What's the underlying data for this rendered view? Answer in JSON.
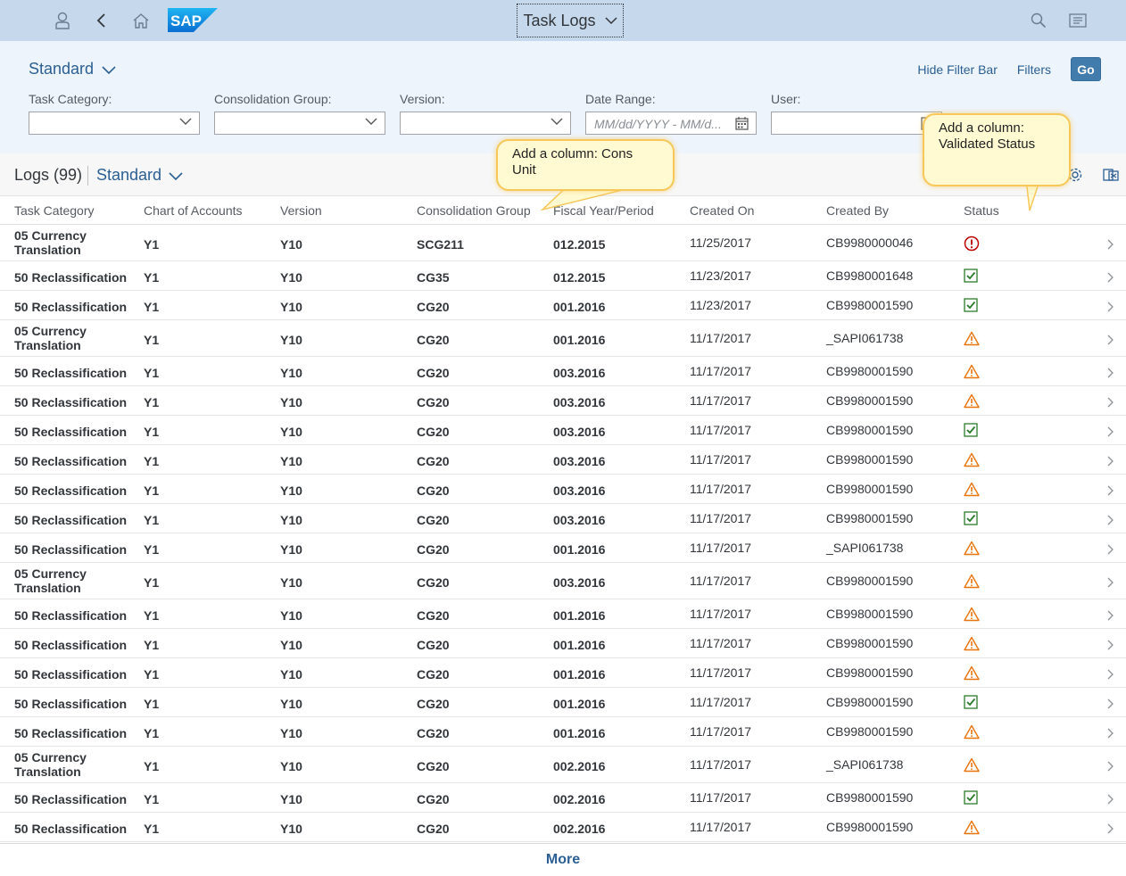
{
  "shell": {
    "title": "Task Logs",
    "logo_text": "SAP"
  },
  "filterbar": {
    "variant": "Standard",
    "hide_filter_bar": "Hide Filter Bar",
    "filters": "Filters",
    "go": "Go",
    "fields": [
      {
        "label": "Task Category:",
        "value": "",
        "placeholder": ""
      },
      {
        "label": "Consolidation Group:",
        "value": "",
        "placeholder": ""
      },
      {
        "label": "Version:",
        "value": "",
        "placeholder": ""
      },
      {
        "label": "Date Range:",
        "value": "",
        "placeholder": "MM/dd/YYYY - MM/d..."
      },
      {
        "label": "User:",
        "value": "",
        "placeholder": ""
      }
    ]
  },
  "table": {
    "title": "Logs (99)",
    "variant": "Standard",
    "columns": [
      "Task Category",
      "Chart of Accounts",
      "Version",
      "Consolidation Group",
      "Fiscal Year/Period",
      "Created On",
      "Created By",
      "Status"
    ],
    "rows": [
      {
        "cat": "05 Currency Translation",
        "coa": "Y1",
        "ver": "Y10",
        "cg": "SCG211",
        "fy": "012.2015",
        "co": "11/25/2017",
        "cb": "CB9980000046",
        "status": "error"
      },
      {
        "cat": "50 Reclassification",
        "coa": "Y1",
        "ver": "Y10",
        "cg": "CG35",
        "fy": "012.2015",
        "co": "11/23/2017",
        "cb": "CB9980001648",
        "status": "success"
      },
      {
        "cat": "50 Reclassification",
        "coa": "Y1",
        "ver": "Y10",
        "cg": "CG20",
        "fy": "001.2016",
        "co": "11/23/2017",
        "cb": "CB9980001590",
        "status": "success"
      },
      {
        "cat": "05 Currency Translation",
        "coa": "Y1",
        "ver": "Y10",
        "cg": "CG20",
        "fy": "001.2016",
        "co": "11/17/2017",
        "cb": "_SAPI061738",
        "status": "warning"
      },
      {
        "cat": "50 Reclassification",
        "coa": "Y1",
        "ver": "Y10",
        "cg": "CG20",
        "fy": "003.2016",
        "co": "11/17/2017",
        "cb": "CB9980001590",
        "status": "warning"
      },
      {
        "cat": "50 Reclassification",
        "coa": "Y1",
        "ver": "Y10",
        "cg": "CG20",
        "fy": "003.2016",
        "co": "11/17/2017",
        "cb": "CB9980001590",
        "status": "warning"
      },
      {
        "cat": "50 Reclassification",
        "coa": "Y1",
        "ver": "Y10",
        "cg": "CG20",
        "fy": "003.2016",
        "co": "11/17/2017",
        "cb": "CB9980001590",
        "status": "success"
      },
      {
        "cat": "50 Reclassification",
        "coa": "Y1",
        "ver": "Y10",
        "cg": "CG20",
        "fy": "003.2016",
        "co": "11/17/2017",
        "cb": "CB9980001590",
        "status": "warning"
      },
      {
        "cat": "50 Reclassification",
        "coa": "Y1",
        "ver": "Y10",
        "cg": "CG20",
        "fy": "003.2016",
        "co": "11/17/2017",
        "cb": "CB9980001590",
        "status": "warning"
      },
      {
        "cat": "50 Reclassification",
        "coa": "Y1",
        "ver": "Y10",
        "cg": "CG20",
        "fy": "003.2016",
        "co": "11/17/2017",
        "cb": "CB9980001590",
        "status": "success"
      },
      {
        "cat": "50 Reclassification",
        "coa": "Y1",
        "ver": "Y10",
        "cg": "CG20",
        "fy": "001.2016",
        "co": "11/17/2017",
        "cb": "_SAPI061738",
        "status": "warning"
      },
      {
        "cat": "05 Currency Translation",
        "coa": "Y1",
        "ver": "Y10",
        "cg": "CG20",
        "fy": "003.2016",
        "co": "11/17/2017",
        "cb": "CB9980001590",
        "status": "warning"
      },
      {
        "cat": "50 Reclassification",
        "coa": "Y1",
        "ver": "Y10",
        "cg": "CG20",
        "fy": "001.2016",
        "co": "11/17/2017",
        "cb": "CB9980001590",
        "status": "warning"
      },
      {
        "cat": "50 Reclassification",
        "coa": "Y1",
        "ver": "Y10",
        "cg": "CG20",
        "fy": "001.2016",
        "co": "11/17/2017",
        "cb": "CB9980001590",
        "status": "warning"
      },
      {
        "cat": "50 Reclassification",
        "coa": "Y1",
        "ver": "Y10",
        "cg": "CG20",
        "fy": "001.2016",
        "co": "11/17/2017",
        "cb": "CB9980001590",
        "status": "warning"
      },
      {
        "cat": "50 Reclassification",
        "coa": "Y1",
        "ver": "Y10",
        "cg": "CG20",
        "fy": "001.2016",
        "co": "11/17/2017",
        "cb": "CB9980001590",
        "status": "success"
      },
      {
        "cat": "50 Reclassification",
        "coa": "Y1",
        "ver": "Y10",
        "cg": "CG20",
        "fy": "001.2016",
        "co": "11/17/2017",
        "cb": "CB9980001590",
        "status": "warning"
      },
      {
        "cat": "05 Currency Translation",
        "coa": "Y1",
        "ver": "Y10",
        "cg": "CG20",
        "fy": "002.2016",
        "co": "11/17/2017",
        "cb": "_SAPI061738",
        "status": "warning"
      },
      {
        "cat": "50 Reclassification",
        "coa": "Y1",
        "ver": "Y10",
        "cg": "CG20",
        "fy": "002.2016",
        "co": "11/17/2017",
        "cb": "CB9980001590",
        "status": "success"
      },
      {
        "cat": "50 Reclassification",
        "coa": "Y1",
        "ver": "Y10",
        "cg": "CG20",
        "fy": "002.2016",
        "co": "11/17/2017",
        "cb": "CB9980001590",
        "status": "warning"
      }
    ],
    "more": "More"
  },
  "callouts": {
    "cons_unit": "Add a column: Cons Unit",
    "validated_status": "Add a column: Validated Status"
  },
  "icons": {
    "status_error": "error-circle-icon",
    "status_success": "checkbox-check-icon",
    "status_warning": "warning-triangle-icon"
  },
  "colors": {
    "shell_bg": "#c5d8ec",
    "filterbar_bg": "#eef4fb",
    "link": "#2b5f93",
    "go_button": "#427cac",
    "error": "#bb0000",
    "success": "#2b7c2b",
    "warning": "#e9730c",
    "callout_bg": "#fffad2",
    "callout_border": "#f7c75a"
  }
}
